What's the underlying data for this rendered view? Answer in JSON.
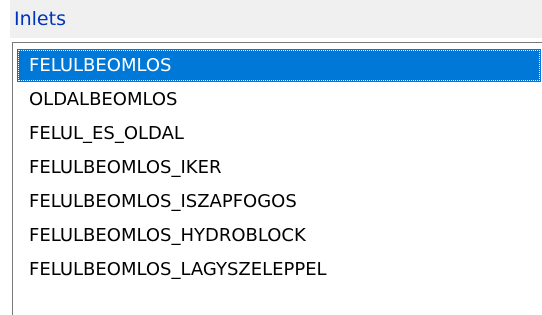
{
  "group": {
    "title": "Inlets"
  },
  "list": {
    "selected_index": 0,
    "items": [
      "FELULBEOMLOS",
      "OLDALBEOMLOS",
      "FELUL_ES_OLDAL",
      "FELULBEOMLOS_IKER",
      "FELULBEOMLOS_ISZAPFOGOS",
      "FELULBEOMLOS_HYDROBLOCK",
      "FELULBEOMLOS_LAGYSZELEPPEL"
    ],
    "colors": {
      "selection": "#0078d7",
      "title": "#0033bb"
    }
  }
}
